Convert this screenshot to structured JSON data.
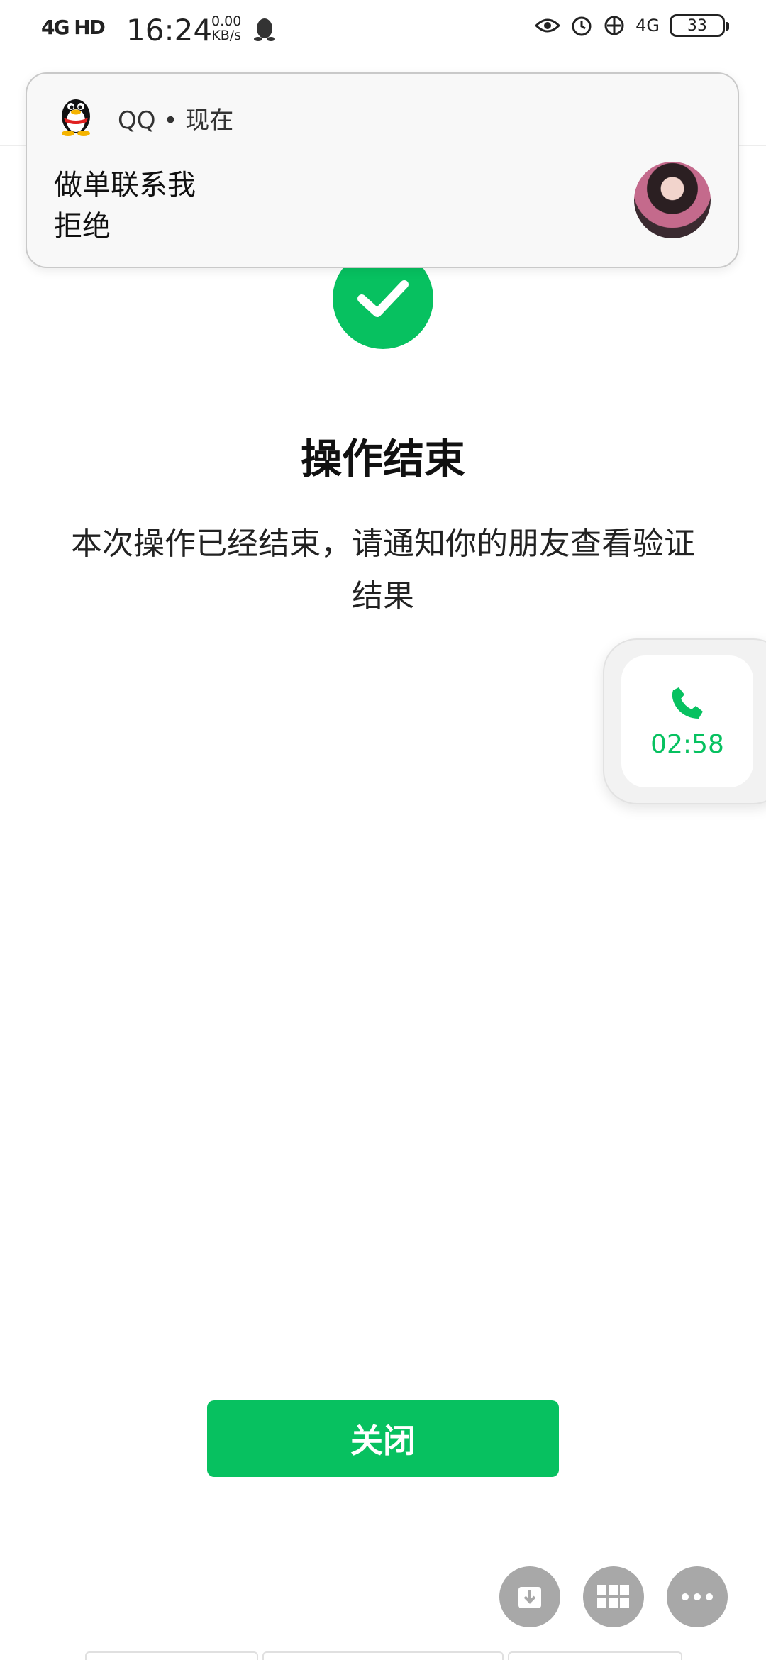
{
  "status_bar": {
    "signal_text": "4G HD",
    "time": "16:24",
    "speed_value": "0.00",
    "speed_unit": "KB/s",
    "network": "4G",
    "battery": "33"
  },
  "notification": {
    "app_label": "QQ • 现在",
    "title": "做单联系我",
    "body": "拒绝"
  },
  "result": {
    "title": "操作结束",
    "description": "本次操作已经结束，请通知你的朋友查看验证结果"
  },
  "floating_call": {
    "timer": "02:58"
  },
  "actions": {
    "close_label": "关闭"
  },
  "colors": {
    "accent": "#07c160",
    "fab_gray": "#a8a8a8"
  },
  "icons": [
    "qq-penguin-icon",
    "eye-icon",
    "alarm-icon",
    "phone-icon",
    "checkmark-icon",
    "download-icon",
    "grid-icon",
    "more-icon"
  ]
}
